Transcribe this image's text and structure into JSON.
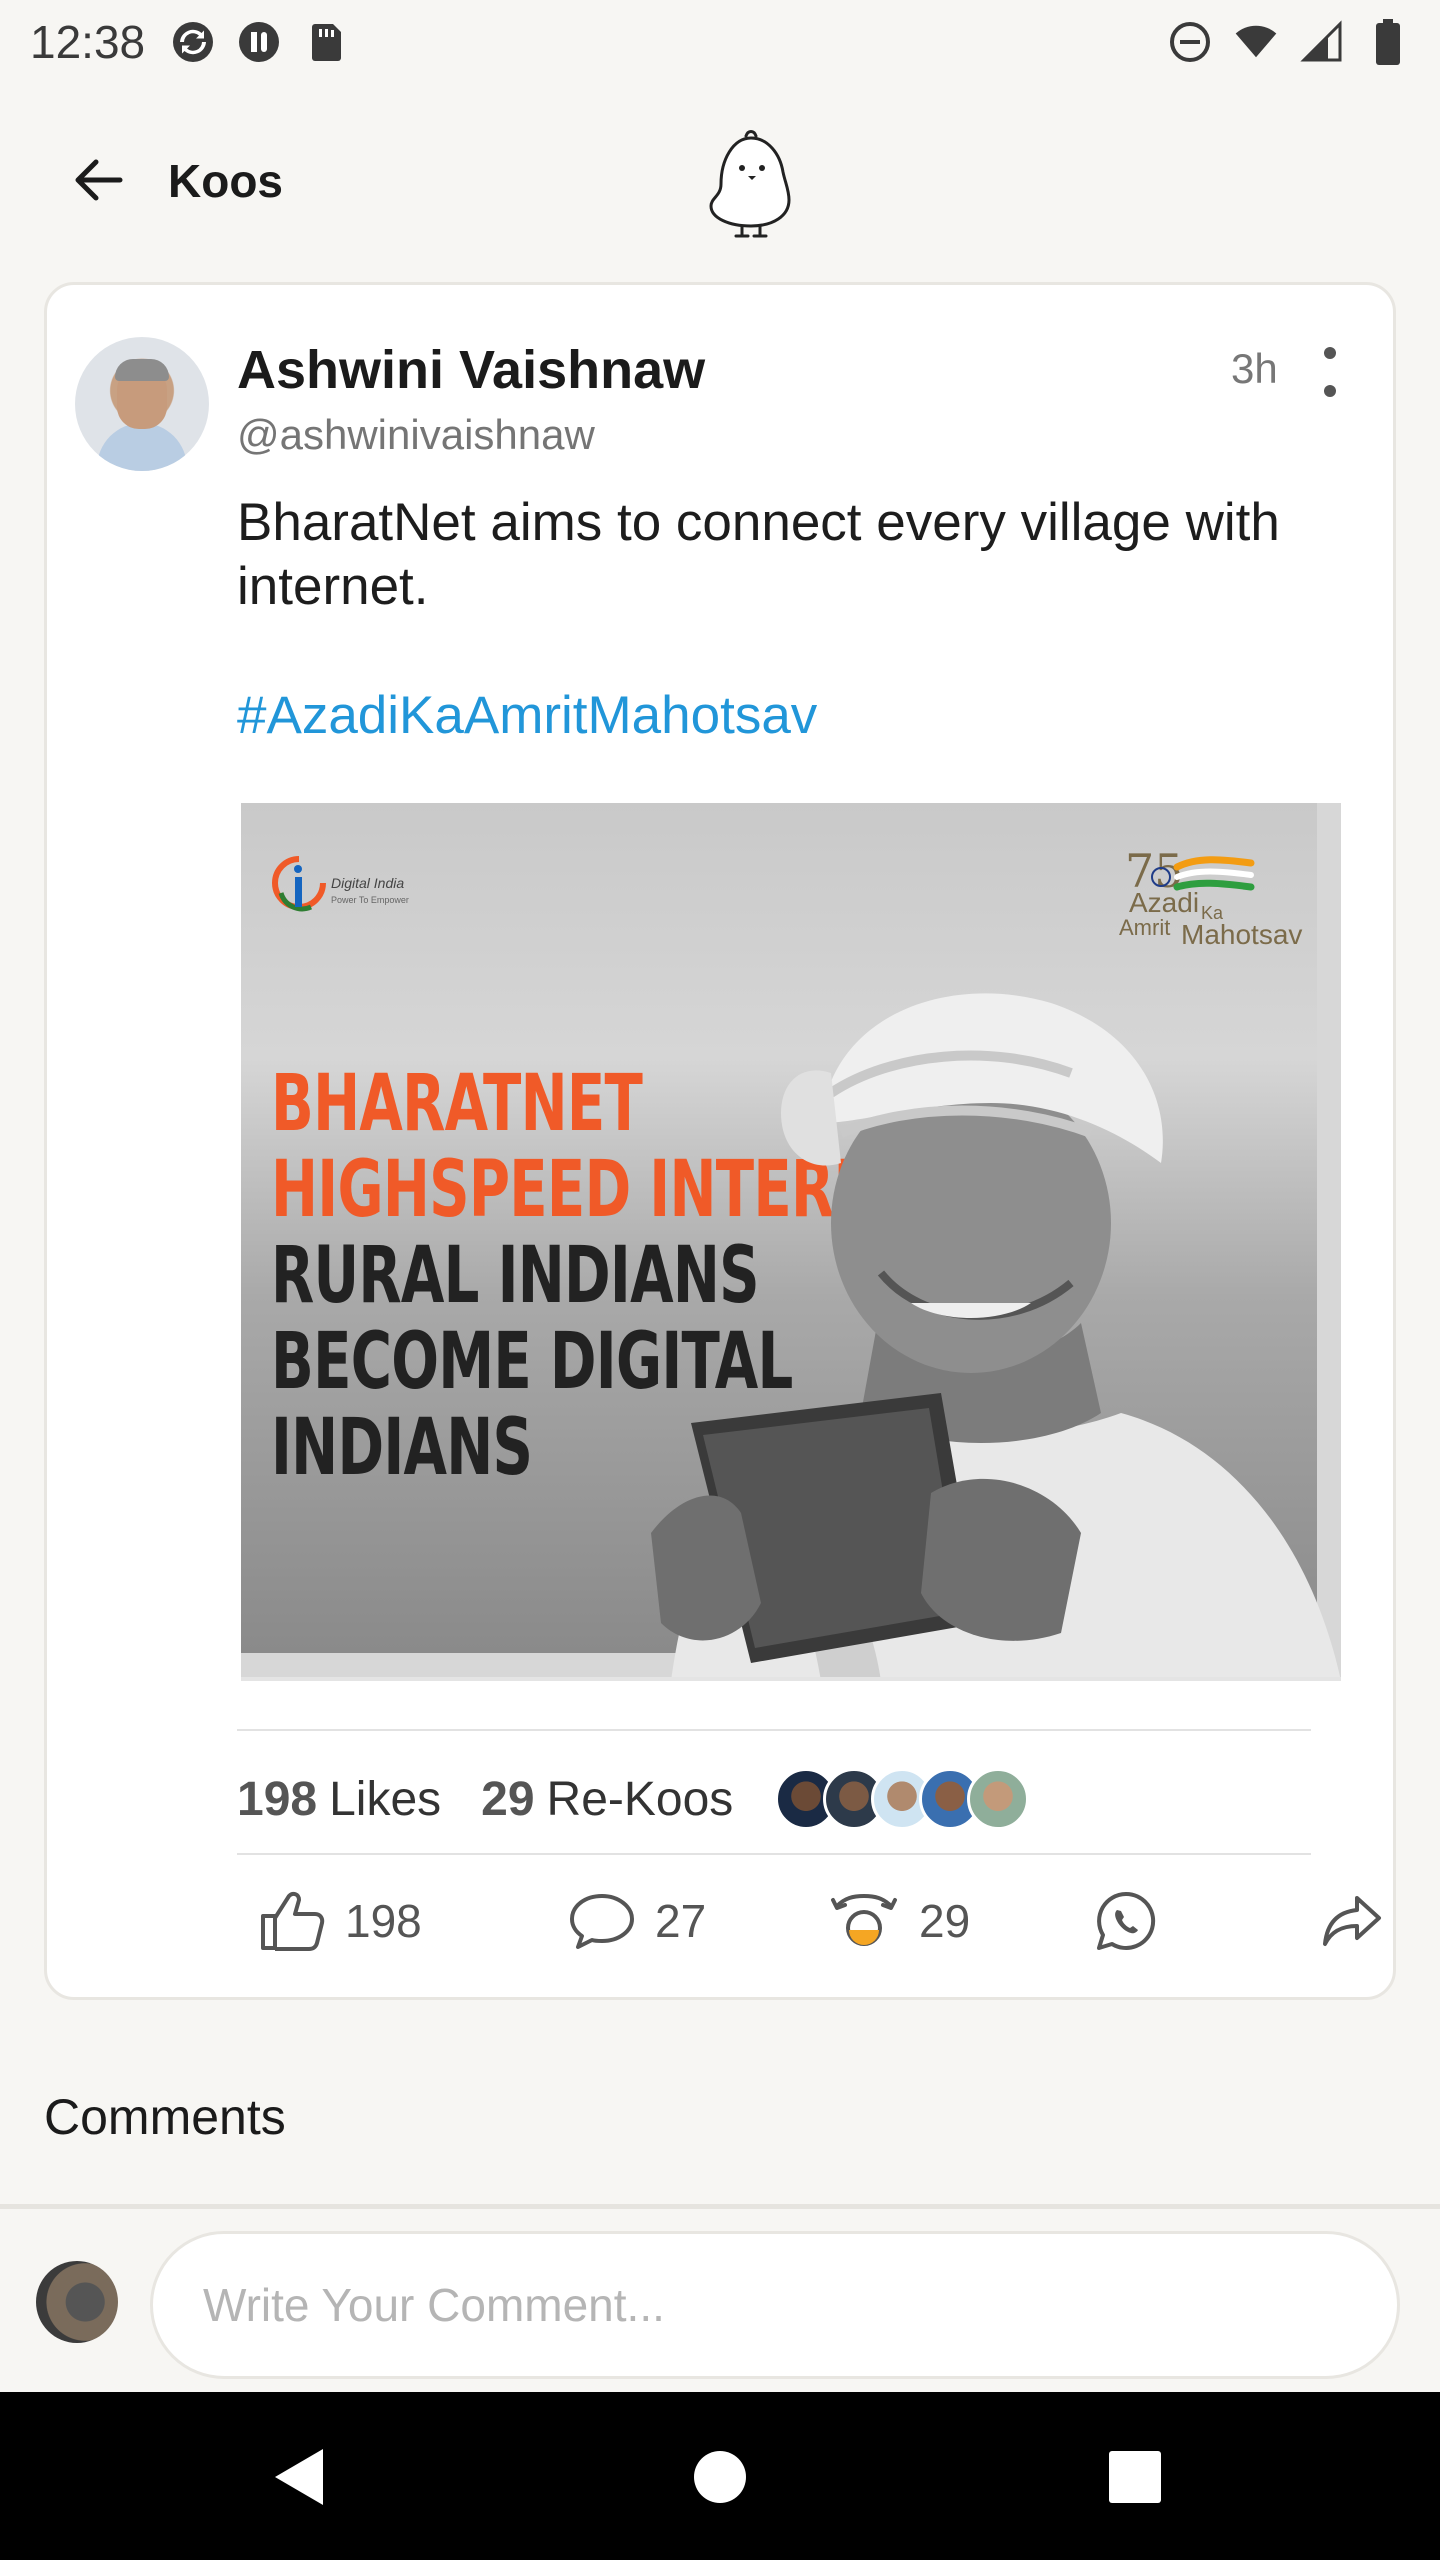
{
  "status_bar": {
    "time": "12:38",
    "left_icons": [
      "sync-icon",
      "pause-icon",
      "sd-card-icon"
    ],
    "right_icons": [
      "do-not-disturb-icon",
      "wifi-icon",
      "signal-icon",
      "battery-icon"
    ]
  },
  "header": {
    "back_icon": "arrow-left-icon",
    "title": "Koos",
    "logo_icon": "koo-bird-logo"
  },
  "post": {
    "author_name": "Ashwini Vaishnaw",
    "author_handle": "@ashwinivaishnaw",
    "time_ago": "3h",
    "text": "BharatNet aims to connect every village with internet.",
    "hashtag": "#AzadiKaAmritMahotsav",
    "image": {
      "logo_left_text": "Digital India",
      "logo_left_sub": "Power To Empower",
      "logo_right_number": "75",
      "logo_right_line1": "Azadi",
      "logo_right_ka": "Ka",
      "logo_right_line2a": "Amrit",
      "logo_right_line2b": "Mahotsav",
      "headline_orange": [
        "BHARATNET",
        "HIGHSPEED INTERNET"
      ],
      "headline_dark": [
        "RURAL INDIANS",
        "BECOME DIGITAL",
        "INDIANS"
      ]
    },
    "stats": {
      "likes_count": "198",
      "likes_label": "Likes",
      "rekoos_count": "29",
      "rekoos_label": "Re-Koos"
    },
    "actions": {
      "like_count": "198",
      "comment_count": "27",
      "rekoo_count": "29"
    }
  },
  "comments": {
    "title": "Comments",
    "input_placeholder": "Write Your Comment..."
  },
  "colors": {
    "accent_link": "#2196d9",
    "headline_orange": "#f05a28",
    "background": "#f7f6f3"
  }
}
